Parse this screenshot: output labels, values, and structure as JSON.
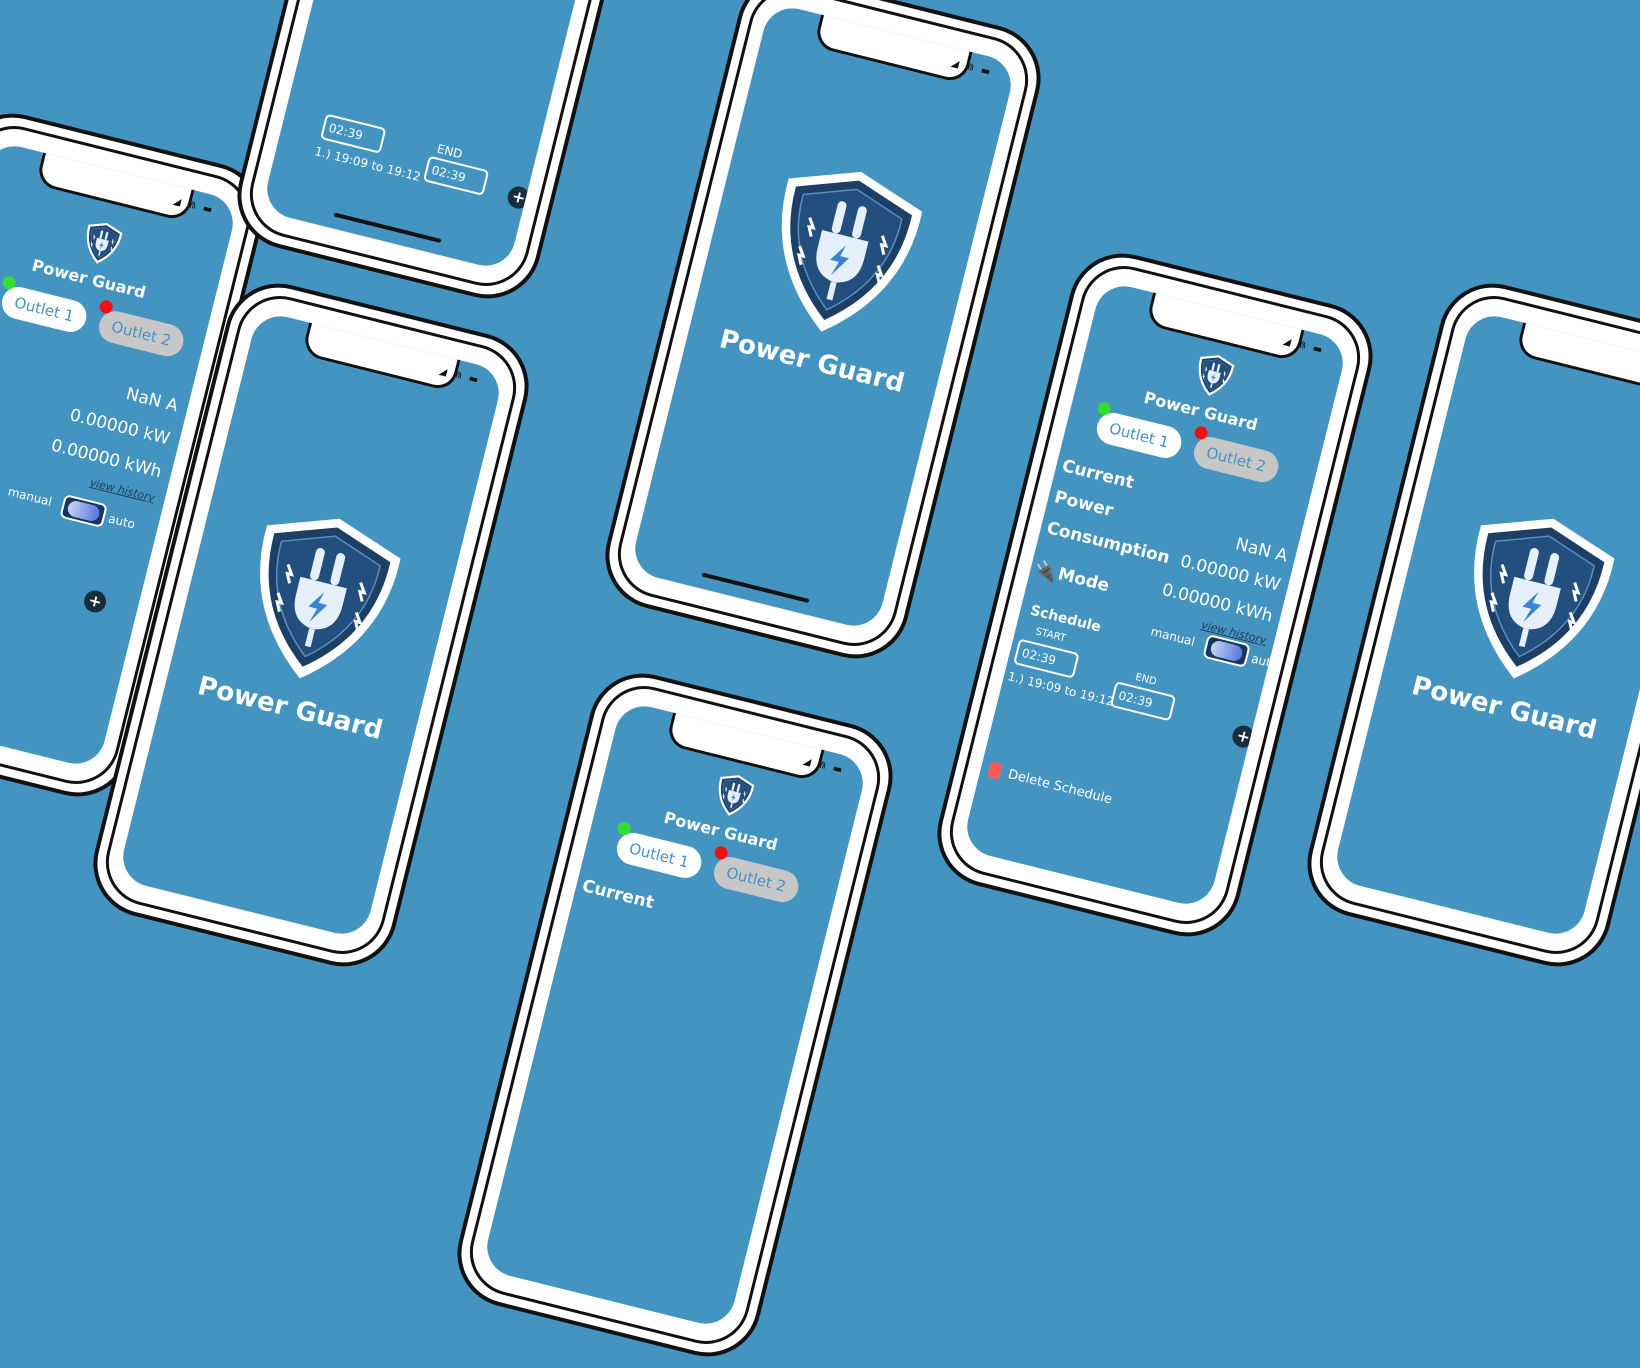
{
  "app": {
    "name": "Power Guard"
  },
  "outlets": [
    {
      "label": "Outlet 1",
      "status_color": "#33dd33"
    },
    {
      "label": "Outlet 2",
      "status_color": "#ee1111"
    }
  ],
  "metrics": {
    "current_label": "Current",
    "power_label": "Power",
    "consumption_label": "Consumption",
    "current_value": "NaN A",
    "power_value": "0.00000 kW",
    "consumption_value": "0.00000 kWh",
    "view_history": "view history"
  },
  "mode": {
    "label": "Mode",
    "manual": "manual",
    "auto": "auto"
  },
  "schedule": {
    "label": "Schedule",
    "start_label": "START",
    "end_label": "END",
    "start_value": "02:39",
    "end_value": "02:39",
    "entry": "1.) 19:09 to 19:12",
    "add": "+",
    "delete": "Delete Schedule"
  },
  "status_bar": {
    "icons": "◢ ⋒ ▬"
  },
  "colors": {
    "background": "#4494c1",
    "accent_on": "#ffffff",
    "accent_off": "#c7c7c7"
  }
}
